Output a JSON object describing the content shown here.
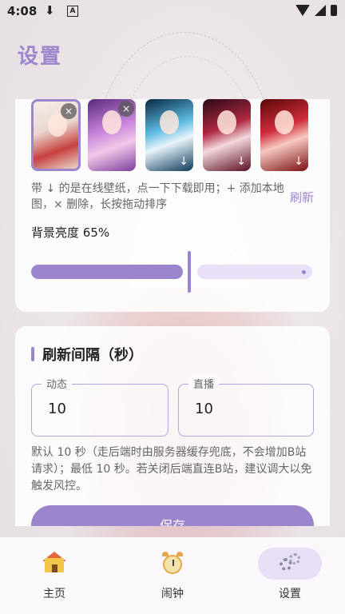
{
  "status": {
    "time": "4:08",
    "download_icon": "download-icon",
    "a_icon": "A"
  },
  "header": {
    "title": "设置"
  },
  "wallpaper": {
    "thumbnails": [
      {
        "selected": true,
        "badge": "×"
      },
      {
        "selected": false,
        "badge": "×"
      },
      {
        "selected": false,
        "badge": "↓"
      },
      {
        "selected": false,
        "badge": "↓"
      },
      {
        "selected": false,
        "badge": "↓"
      }
    ],
    "hint": "带 ↓ 的是在线壁纸，点一下下载即用；+ 添加本地图，× 删除，长按拖动排序",
    "refresh_label": "刷新",
    "brightness_label": "背景亮度 65%",
    "brightness_value": 0.65
  },
  "refresh_interval": {
    "title": "刷新间隔（秒）",
    "dynamic_label": "动态",
    "dynamic_value": "10",
    "live_label": "直播",
    "live_value": "10",
    "note": "默认 10 秒（走后端时由服务器缓存兜底，不会增加B站请求）；最低 10 秒。若关闭后端直连B站，建议调大以免触发风控。",
    "save_label": "保存"
  },
  "nav": {
    "items": [
      {
        "label": "主页",
        "icon": "home-icon",
        "active": false
      },
      {
        "label": "闹钟",
        "icon": "alarm-clock-icon",
        "active": false
      },
      {
        "label": "设置",
        "icon": "settings-gear-icon",
        "active": true
      }
    ]
  },
  "colors": {
    "accent": "#9b85cc",
    "accent_light": "#e8e0f4"
  }
}
